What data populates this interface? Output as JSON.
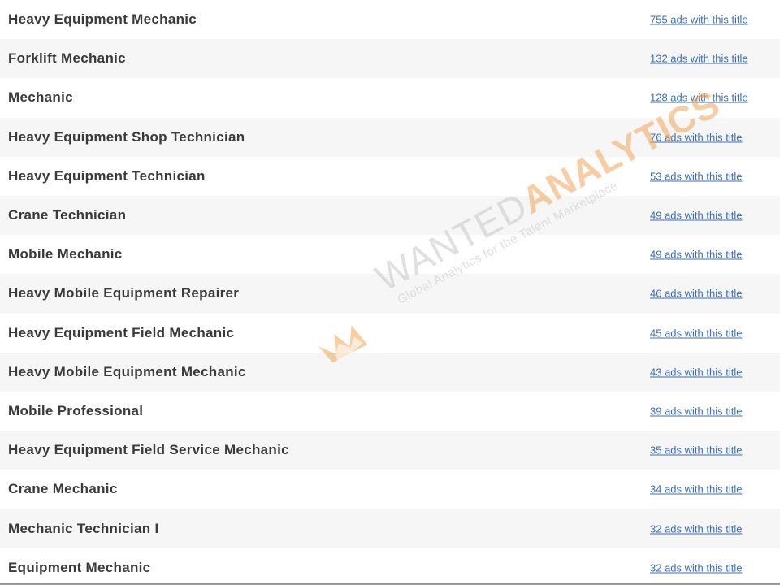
{
  "rows": [
    {
      "title": "Heavy Equipment Mechanic",
      "link": "755 ads with this title"
    },
    {
      "title": "Forklift Mechanic",
      "link": "132 ads with this title"
    },
    {
      "title": "Mechanic",
      "link": "128 ads with this title"
    },
    {
      "title": "Heavy Equipment Shop Technician",
      "link": "76 ads with this title"
    },
    {
      "title": "Heavy Equipment Technician",
      "link": "53 ads with this title"
    },
    {
      "title": "Crane Technician",
      "link": "49 ads with this title"
    },
    {
      "title": "Mobile Mechanic",
      "link": "49 ads with this title"
    },
    {
      "title": "Heavy Mobile Equipment Repairer",
      "link": "46 ads with this title"
    },
    {
      "title": "Heavy Equipment Field Mechanic",
      "link": "45 ads with this title"
    },
    {
      "title": "Heavy Mobile Equipment Mechanic",
      "link": "43 ads with this title"
    },
    {
      "title": "Mobile Professional",
      "link": "39 ads with this title"
    },
    {
      "title": "Heavy Equipment Field Service Mechanic",
      "link": "35 ads with this title"
    },
    {
      "title": "Crane Mechanic",
      "link": "34 ads with this title"
    },
    {
      "title": "Mechanic Technician I",
      "link": "32 ads with this title"
    },
    {
      "title": "Equipment Mechanic",
      "link": "32 ads with this title"
    }
  ],
  "watermark": {
    "brand_part1": "WANTED",
    "brand_part2": "ANALYTICS",
    "tagline": "Global Analytics for the Talent Marketplace"
  },
  "colors": {
    "title_text": "#3a3a3a",
    "link": "#3b6eb8",
    "row_alt": "#f6f6f6",
    "watermark_orange": "#f2a75a"
  }
}
